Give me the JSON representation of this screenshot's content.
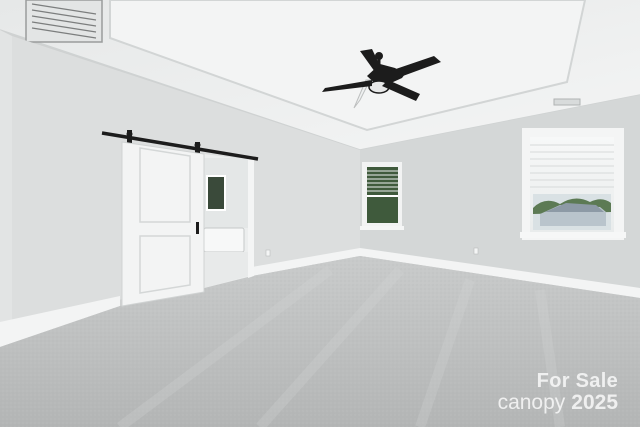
{
  "watermark": {
    "line1": "For Sale",
    "brand": "canopy",
    "year": "2025"
  },
  "colors": {
    "ceiling": "#eef0f0",
    "wall_left": "#dddfdf",
    "wall_back": "#d6d9d9",
    "wall_right": "#d3d6d6",
    "carpet": "#bdbfbf",
    "trim": "#f4f5f5",
    "door": "#f3f4f4",
    "hardware": "#1c1c1c"
  },
  "icons": [
    "ceiling-fan-icon",
    "air-vent-icon",
    "barn-door-rail-icon"
  ]
}
